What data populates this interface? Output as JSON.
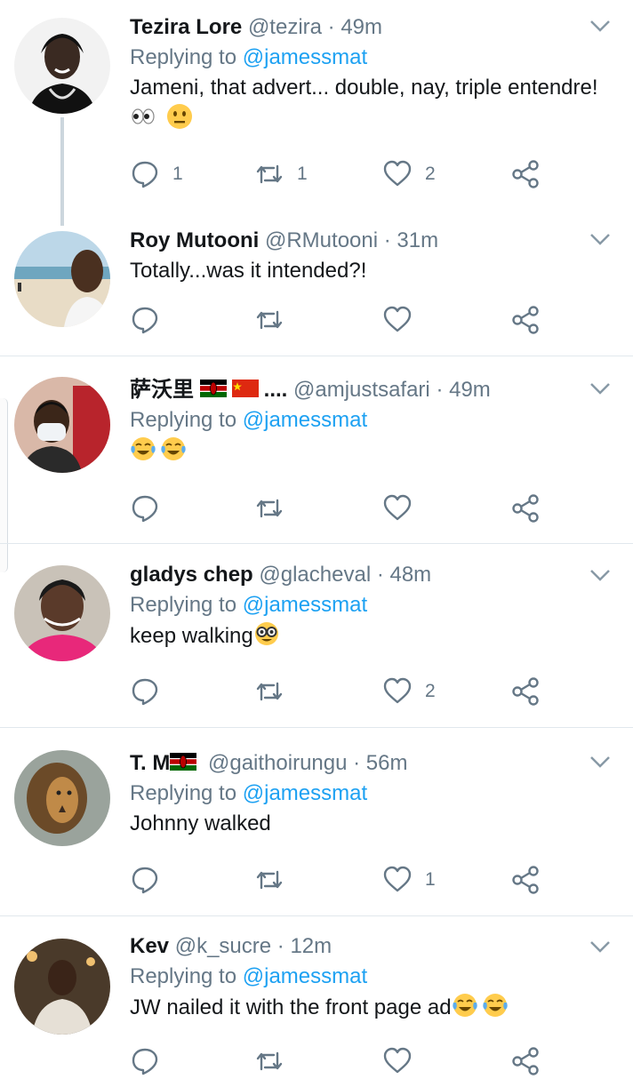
{
  "tweets": [
    {
      "name": "Tezira Lore",
      "handle": "@tezira",
      "time": "· 49m",
      "replying_label": "Replying to",
      "replying_to": "@jamessmat",
      "text_lines": [
        "Jameni, that advert... double, nay, triple entendre!",
        ""
      ],
      "emojis": [
        "eyes",
        "neutral-face"
      ],
      "counts": {
        "reply": "1",
        "retweet": "1",
        "like": "2"
      }
    },
    {
      "name": "Roy Mutooni",
      "handle": "@RMutooni",
      "time": "· 31m",
      "text": "Totally...was it intended?!",
      "counts": {
        "reply": "",
        "retweet": "",
        "like": ""
      }
    },
    {
      "name": "萨沃里",
      "name_suffix": "....",
      "handle": "@amjustsafari",
      "time": "· 49m",
      "replying_label": "Replying to",
      "replying_to": "@jamessmat",
      "emojis": [
        "tears-of-joy",
        "tears-of-joy"
      ],
      "counts": {
        "reply": "",
        "retweet": "",
        "like": ""
      }
    },
    {
      "name": "gladys chep",
      "handle": "@glacheval",
      "time": "· 48m",
      "replying_label": "Replying to",
      "replying_to": "@jamessmat",
      "text": "keep walking",
      "counts": {
        "reply": "",
        "retweet": "",
        "like": "2"
      }
    },
    {
      "name": "T. M",
      "handle": "@gaithoirungu",
      "time": "· 56m",
      "replying_label": "Replying to",
      "replying_to": "@jamessmat",
      "text": "Johnny walked",
      "counts": {
        "reply": "",
        "retweet": "",
        "like": "1"
      }
    },
    {
      "name": "Kev",
      "handle": "@k_sucre",
      "time": "· 12m",
      "replying_label": "Replying to",
      "replying_to": "@jamessmat",
      "text": "JW nailed it with the front page ad",
      "counts": {
        "reply": "",
        "retweet": "",
        "like": ""
      }
    }
  ],
  "icons": {
    "reply": "reply-icon",
    "retweet": "retweet-icon",
    "like": "like-icon",
    "share": "share-icon",
    "caret": "chevron-down-icon"
  },
  "colors": {
    "link": "#1da1f2",
    "secondary": "#657786",
    "divider": "#e1e8ed",
    "text": "#14171a"
  }
}
